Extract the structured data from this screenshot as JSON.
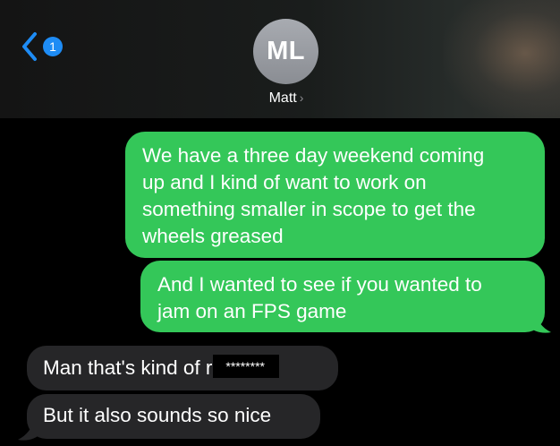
{
  "header": {
    "back_badge_count": "1",
    "avatar_initials": "ML",
    "contact_name": "Matt",
    "contact_chevron": "›"
  },
  "messages": [
    {
      "direction": "sent",
      "lines": [
        "We have a three day weekend coming",
        "up and I kind of want to work on",
        "something smaller in scope to get the",
        "wheels greased"
      ]
    },
    {
      "direction": "sent",
      "lines": [
        "And I wanted to see if you wanted to",
        "jam on an FPS game"
      ]
    },
    {
      "direction": "received",
      "text_visible": "Man that's kind of r",
      "redacted_text": "********"
    },
    {
      "direction": "received",
      "text": "But it also sounds so nice"
    }
  ],
  "colors": {
    "sent_bubble": "#34c759",
    "received_bubble": "#262628",
    "badge": "#1e8cf5",
    "back_chevron": "#1e8cf5",
    "background": "#000000"
  },
  "icons": {
    "back": "chevron-left-icon",
    "contact_detail": "chevron-right-icon"
  }
}
